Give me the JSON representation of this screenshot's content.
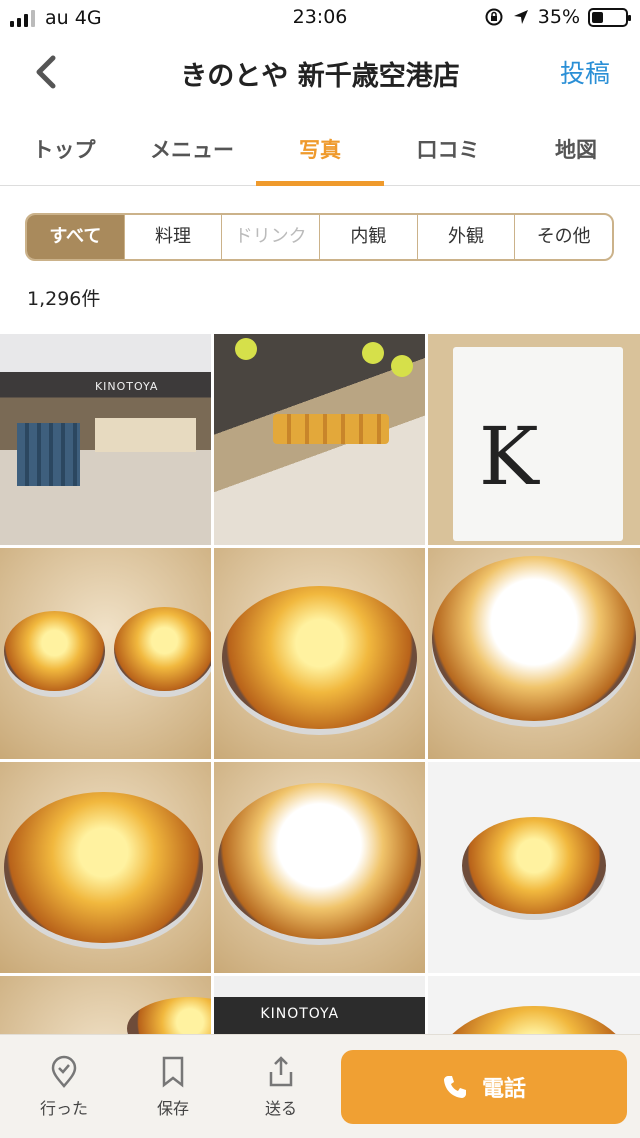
{
  "status_bar": {
    "carrier": "au 4G",
    "time": "23:06",
    "battery_percent": "35%",
    "battery_level": 0.35
  },
  "header": {
    "title": "きのとや 新千歳空港店",
    "post_label": "投稿"
  },
  "tabs": [
    {
      "label": "トップ",
      "active": false
    },
    {
      "label": "メニュー",
      "active": false
    },
    {
      "label": "写真",
      "active": true
    },
    {
      "label": "口コミ",
      "active": false
    },
    {
      "label": "地図",
      "active": false
    }
  ],
  "filter": [
    {
      "label": "すべて",
      "state": "active"
    },
    {
      "label": "料理",
      "state": "normal"
    },
    {
      "label": "ドリンク",
      "state": "disabled"
    },
    {
      "label": "内観",
      "state": "normal"
    },
    {
      "label": "外観",
      "state": "normal"
    },
    {
      "label": "その他",
      "state": "normal"
    }
  ],
  "count_text": "1,296件",
  "photos": {
    "store_sign": "KINOTOYA",
    "bag_letter": "K",
    "sign_bottom": "KINOTOYA"
  },
  "bottom_bar": {
    "went_label": "行った",
    "save_label": "保存",
    "send_label": "送る",
    "call_label": "電話"
  },
  "colors": {
    "accent": "#ef9a2c",
    "link": "#2a8fd6",
    "filter_active": "#a98a5c"
  }
}
